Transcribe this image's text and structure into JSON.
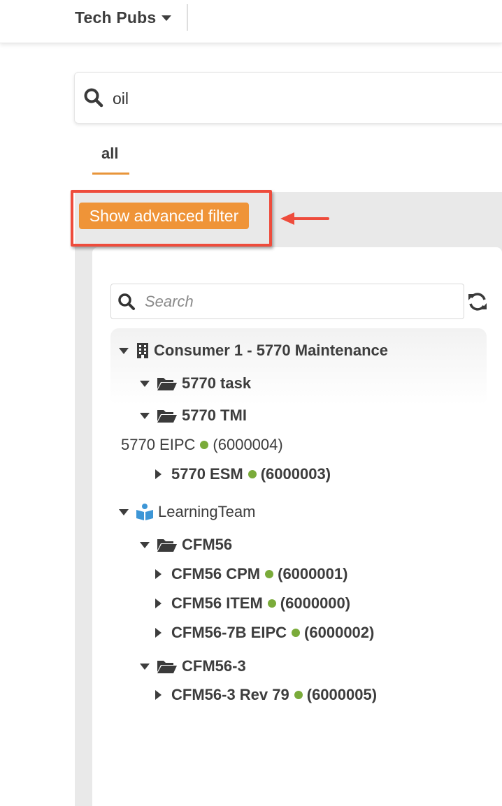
{
  "header": {
    "app_name": "Tech Pubs"
  },
  "search": {
    "query": "oil"
  },
  "tabs": [
    {
      "label": "all",
      "active": true
    }
  ],
  "filter": {
    "button_label": "Show advanced filter"
  },
  "tree_search": {
    "placeholder": "Search"
  },
  "tree": {
    "consumer": {
      "label": "Consumer 1 - 5770 Maintenance"
    },
    "folder_task": {
      "label": "5770 task"
    },
    "folder_tmi": {
      "label": "5770 TMI"
    },
    "eipc": {
      "label": "5770 EIPC",
      "id": "(6000004)"
    },
    "esm": {
      "label": "5770 ESM",
      "id": "(6000003)"
    },
    "team": {
      "label": "LearningTeam"
    },
    "folder_cfm56": {
      "label": "CFM56"
    },
    "cfm56_cpm": {
      "label": "CFM56 CPM",
      "id": "(6000001)"
    },
    "cfm56_item": {
      "label": "CFM56 ITEM",
      "id": "(6000000)"
    },
    "cfm56_7b": {
      "label": "CFM56-7B EIPC",
      "id": "(6000002)"
    },
    "folder_cfm56_3": {
      "label": "CFM56-3"
    },
    "cfm56_3_rev": {
      "label": "CFM56-3 Rev 79",
      "id": "(6000005)"
    }
  },
  "colors": {
    "accent": "#ef9438",
    "highlight": "#ee4c3c",
    "status_dot": "#7aab3a",
    "tab_underline": "#e8953a",
    "team_icon": "#3d96d6"
  },
  "icons": {
    "search": "search-icon",
    "refresh": "refresh-icon",
    "building": "building-icon",
    "folder": "folder-icon",
    "team": "book-person-icon"
  }
}
